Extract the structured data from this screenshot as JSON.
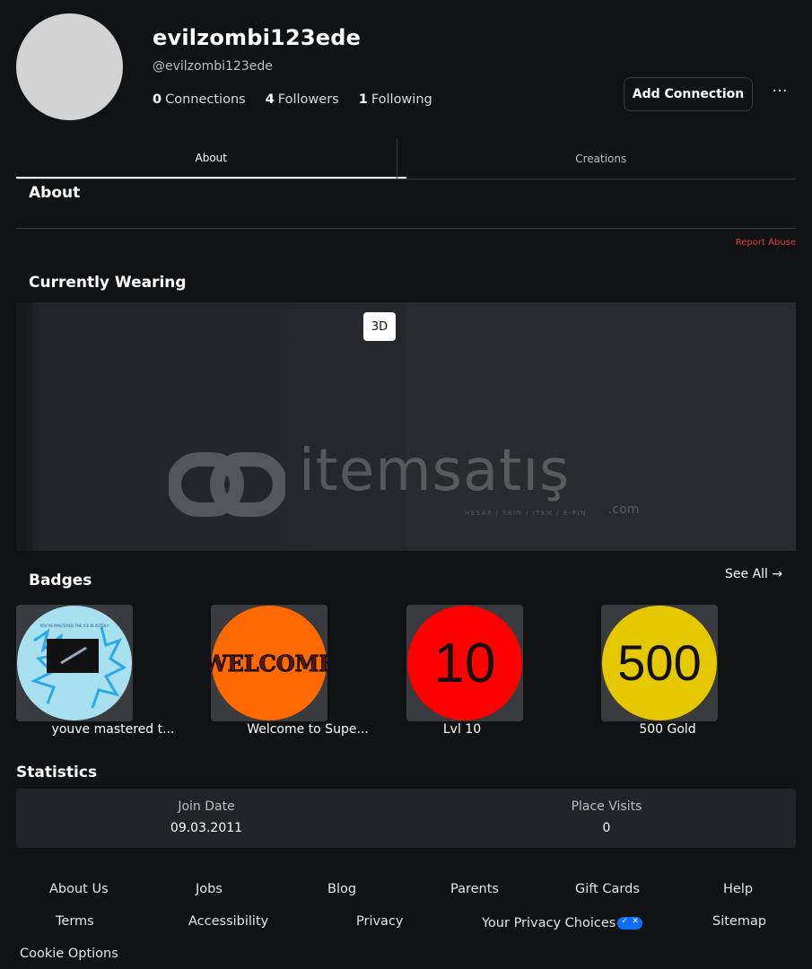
{
  "profile": {
    "display_name": "evilzombi123ede",
    "handle": "@evilzombi123ede",
    "connections_count": "0",
    "connections_label": "Connections",
    "followers_count": "4",
    "followers_label": "Followers",
    "following_count": "1",
    "following_label": "Following",
    "add_connection_label": "Add Connection",
    "more_label": "···"
  },
  "tabs": [
    {
      "label": "About",
      "active": true
    },
    {
      "label": "Creations",
      "active": false
    }
  ],
  "about": {
    "title": "About",
    "report_label": "Report Abuse"
  },
  "wearing": {
    "title": "Currently Wearing",
    "toggle_3d_label": "3D",
    "watermark_text": "itemsatış",
    "watermark_sub": "HESAP / SKIN / ITEM / E-PIN",
    "watermark_com": ".com"
  },
  "badges": {
    "title": "Badges",
    "see_all_label": "See All →",
    "items": [
      {
        "name": "youve mastered t...",
        "icon": "blue-splash-badge-icon",
        "art_text": "YOU'VE MASTERED THE ICE BLASTER!!"
      },
      {
        "name": "Welcome to Supe...",
        "icon": "welcome-badge-icon",
        "art_text": "WELCOME"
      },
      {
        "name": "Lvl 10",
        "icon": "level-10-badge-icon",
        "art_text": "10"
      },
      {
        "name": "500 Gold",
        "icon": "gold-500-badge-icon",
        "art_text": "500"
      }
    ]
  },
  "statistics": {
    "title": "Statistics",
    "join_date_label": "Join Date",
    "join_date_value": "09.03.2011",
    "place_visits_label": "Place Visits",
    "place_visits_value": "0"
  },
  "footer": {
    "about_us": "About Us",
    "jobs": "Jobs",
    "blog": "Blog",
    "parents": "Parents",
    "gift_cards": "Gift Cards",
    "help": "Help",
    "terms": "Terms",
    "accessibility": "Accessibility",
    "privacy": "Privacy",
    "privacy_choices": "Your Privacy Choices",
    "sitemap": "Sitemap",
    "cookie_options": "Cookie Options"
  },
  "colors": {
    "background": "#111214",
    "report_abuse": "#e23c3c",
    "privacy_toggle": "#0d6efd",
    "badge_blue": "#a8e0f0",
    "badge_orange": "#ff6a00",
    "badge_red": "#ff0000",
    "badge_gold": "#e6c800"
  }
}
